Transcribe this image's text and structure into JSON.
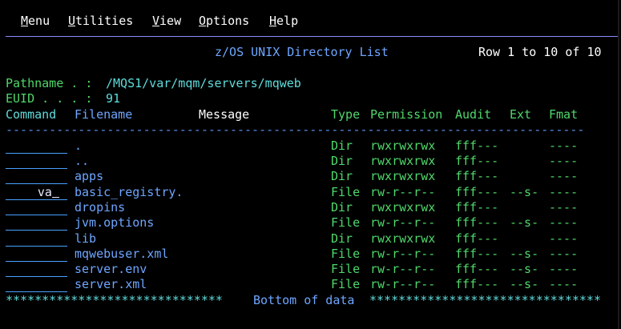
{
  "menubar": {
    "items": [
      {
        "hot": "M",
        "rest": "enu"
      },
      {
        "hot": "U",
        "rest": "tilities"
      },
      {
        "hot": "V",
        "rest": "iew"
      },
      {
        "hot": "O",
        "rest": "ptions"
      },
      {
        "hot": "H",
        "rest": "elp"
      }
    ]
  },
  "header": {
    "title": "z/OS UNIX Directory List",
    "row_info": "Row 1 to 10 of 10"
  },
  "pathname": {
    "label": "Pathname . :",
    "value": "/MQS1/var/mqm/servers/mqweb"
  },
  "euid": {
    "label": "EUID . . . :",
    "value": "91"
  },
  "columns": {
    "command": "Command",
    "filename": "Filename",
    "message": "Message",
    "type": "Type",
    "permission": "Permission",
    "audit": "Audit",
    "ext": "Ext",
    "fmat": "Fmat"
  },
  "separator": "--------------------------------------------------------------------------------",
  "rows": [
    {
      "cmd": "",
      "name": ".",
      "type": "Dir",
      "perm": "rwxrwxrwx",
      "audit": "fff---",
      "ext": "",
      "fmat": "----"
    },
    {
      "cmd": "",
      "name": "..",
      "type": "Dir",
      "perm": "rwxrwxrwx",
      "audit": "fff---",
      "ext": "",
      "fmat": "----"
    },
    {
      "cmd": "",
      "name": "apps",
      "type": "Dir",
      "perm": "rwxrwxrwx",
      "audit": "fff---",
      "ext": "",
      "fmat": "----"
    },
    {
      "cmd": "va",
      "name": "basic_registry.",
      "type": "File",
      "perm": "rw-r--r--",
      "audit": "fff---",
      "ext": "--s-",
      "fmat": "----"
    },
    {
      "cmd": "",
      "name": "dropins",
      "type": "Dir",
      "perm": "rwxrwxrwx",
      "audit": "fff---",
      "ext": "",
      "fmat": "----"
    },
    {
      "cmd": "",
      "name": "jvm.options",
      "type": "File",
      "perm": "rw-r--r--",
      "audit": "fff---",
      "ext": "--s-",
      "fmat": "----"
    },
    {
      "cmd": "",
      "name": "lib",
      "type": "Dir",
      "perm": "rwxrwxrwx",
      "audit": "fff---",
      "ext": "",
      "fmat": "----"
    },
    {
      "cmd": "",
      "name": "mqwebuser.xml",
      "type": "File",
      "perm": "rw-r--r--",
      "audit": "fff---",
      "ext": "--s-",
      "fmat": "----"
    },
    {
      "cmd": "",
      "name": "server.env",
      "type": "File",
      "perm": "rw-r--r--",
      "audit": "fff---",
      "ext": "--s-",
      "fmat": "----"
    },
    {
      "cmd": "",
      "name": "server.xml",
      "type": "File",
      "perm": "rw-r--r--",
      "audit": "fff---",
      "ext": "--s-",
      "fmat": "----"
    }
  ],
  "footer": {
    "left_stars": "******************************",
    "text": "Bottom of data",
    "right_stars": "********************************"
  }
}
